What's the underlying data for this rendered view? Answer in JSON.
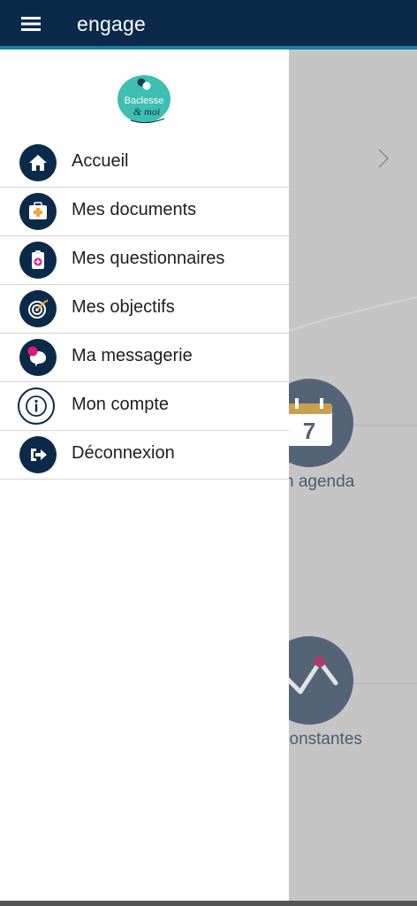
{
  "appbar": {
    "title": "engage",
    "menu_icon": "hamburger-menu-icon"
  },
  "logo": {
    "line1": "Baclesse",
    "line2": "& moi"
  },
  "drawer": {
    "items": [
      {
        "label": "Accueil",
        "icon": "home-icon"
      },
      {
        "label": "Mes documents",
        "icon": "medical-kit-icon"
      },
      {
        "label": "Mes questionnaires",
        "icon": "clipboard-icon"
      },
      {
        "label": "Mes objectifs",
        "icon": "target-icon"
      },
      {
        "label": "Ma messagerie",
        "icon": "chat-bubble-icon"
      },
      {
        "label": "Mon compte",
        "icon": "info-icon"
      },
      {
        "label": "Déconnexion",
        "icon": "logout-icon"
      }
    ]
  },
  "background": {
    "agenda_label": "n agenda",
    "constantes_label": "constantes",
    "calendar_day": "7"
  },
  "colors": {
    "primary": "#0b2a4a",
    "accent": "#1b7fa1",
    "pink": "#e0197d",
    "orange": "#f0a63a"
  }
}
